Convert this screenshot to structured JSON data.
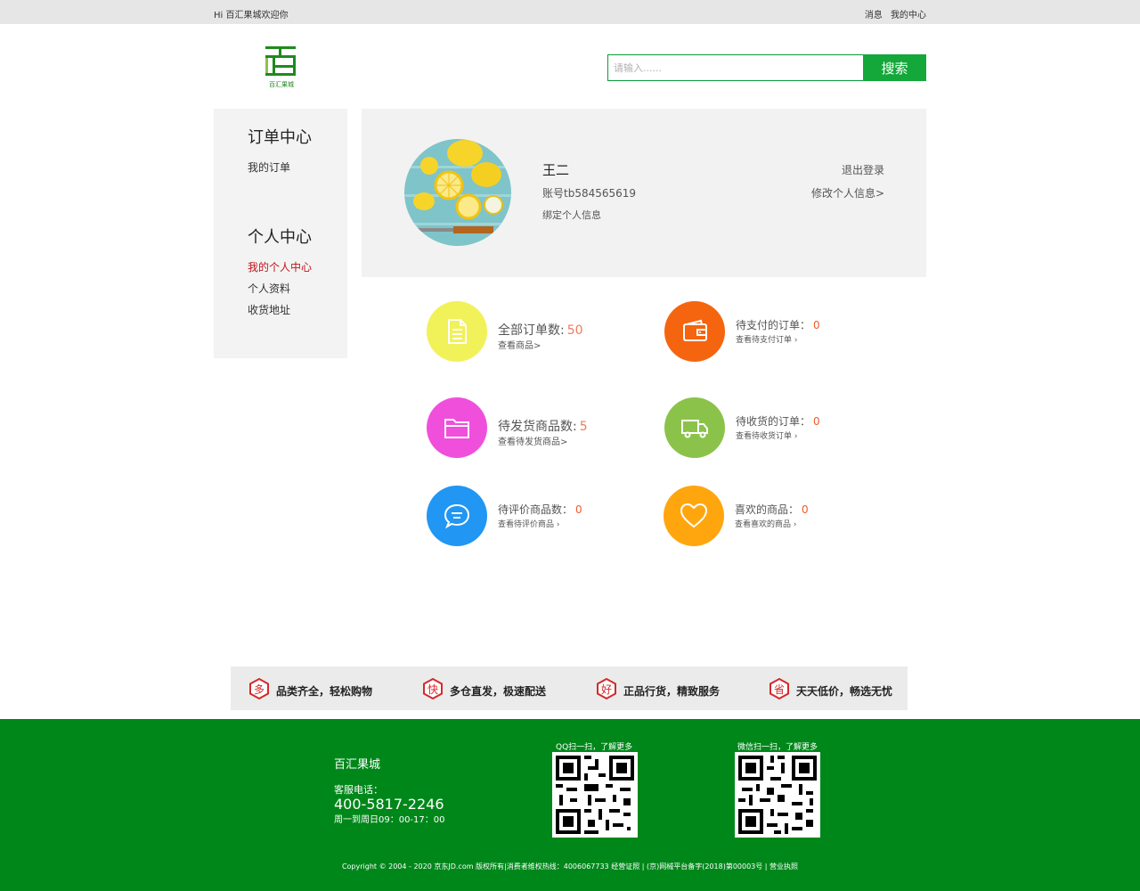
{
  "topbar": {
    "welcome": "Hi 百汇果城欢迎你",
    "links": [
      "消息",
      "我的中心"
    ]
  },
  "logo": {
    "caption": "百汇果城"
  },
  "search": {
    "placeholder": "请输入......",
    "button_label": "搜索"
  },
  "sidebar": {
    "sections": [
      {
        "title": "订单中心",
        "items": [
          "我的订单"
        ]
      },
      {
        "title": "个人中心",
        "items": [
          "我的个人中心",
          "个人资料",
          "收货地址"
        ]
      }
    ],
    "active_item": "我的个人中心"
  },
  "profile": {
    "name": "王二",
    "account": "账号tb584565619",
    "bind": "绑定个人信息",
    "logout": "退出登录",
    "modify": "修改个人信息>"
  },
  "stats": [
    {
      "title": "全部订单数:",
      "count": "50",
      "link": "查看商品>",
      "color": "#f1f15a",
      "icon": "document-icon"
    },
    {
      "title": "待支付的订单：",
      "count": "0",
      "link": "查看待支付订单 ›",
      "color": "#f5650f",
      "icon": "wallet-icon"
    },
    {
      "title": "待发货商品数:",
      "count": "5",
      "link": "查看待发货商品>",
      "color": "#f04fdc",
      "icon": "folder-icon"
    },
    {
      "title": "待收货的订单：",
      "count": "0",
      "link": "查看待收货订单 ›",
      "color": "#8bc34a",
      "icon": "truck-icon"
    },
    {
      "title": "待评价商品数：",
      "count": "0",
      "link": "查看待评价商品 ›",
      "color": "#2196f3",
      "icon": "comment-icon"
    },
    {
      "title": "喜欢的商品：",
      "count": "0",
      "link": "查看喜欢的商品 ›",
      "color": "#ffa60f",
      "icon": "heart-icon"
    }
  ],
  "features": [
    {
      "badge": "多",
      "text": "品类齐全，轻松购物"
    },
    {
      "badge": "快",
      "text": "多仓直发，极速配送"
    },
    {
      "badge": "好",
      "text": "正品行货，精致服务"
    },
    {
      "badge": "省",
      "text": "天天低价，畅选无忧"
    }
  ],
  "footer": {
    "brand": "百汇果城",
    "service_label": "客服电话：",
    "phone": "400-5817-2246",
    "hours": "周一到周日09：00-17：00",
    "qq_label": "QQ扫一扫，了解更多",
    "wechat_label": "微信扫一扫，了解更多",
    "copyright": "Copyright © 2004 - 2020 京东JD.com 版权所有|消费者维权热线：4006067733 经营证照 | (京)网械平台备字(2018)第00003号 | 营业执照"
  },
  "colors": {
    "brand_green": "#00871a",
    "search_green": "#14a83b",
    "active_red": "#c0131c",
    "count_orange": "#f25a2a"
  }
}
